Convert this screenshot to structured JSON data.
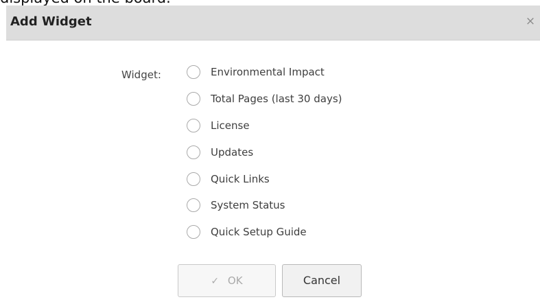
{
  "background_caption": "displayed on the board.",
  "dialog": {
    "title": "Add Widget",
    "close_icon": "close-icon",
    "close_symbol": "×"
  },
  "widget_field": {
    "label": "Widget:",
    "options": [
      {
        "label": "Environmental Impact"
      },
      {
        "label": "Total Pages (last 30 days)"
      },
      {
        "label": "License"
      },
      {
        "label": "Updates"
      },
      {
        "label": "Quick Links"
      },
      {
        "label": "System Status"
      },
      {
        "label": "Quick Setup Guide"
      }
    ],
    "selected": null
  },
  "footer": {
    "ok_label": "OK",
    "ok_icon": "check-icon",
    "ok_icon_symbol": "✓",
    "cancel_label": "Cancel"
  },
  "colors": {
    "header_background": "#dddddd",
    "dialog_background": "#ffffff",
    "radio_border": "#a9a9a9",
    "disabled_text": "#aaaaaa"
  }
}
